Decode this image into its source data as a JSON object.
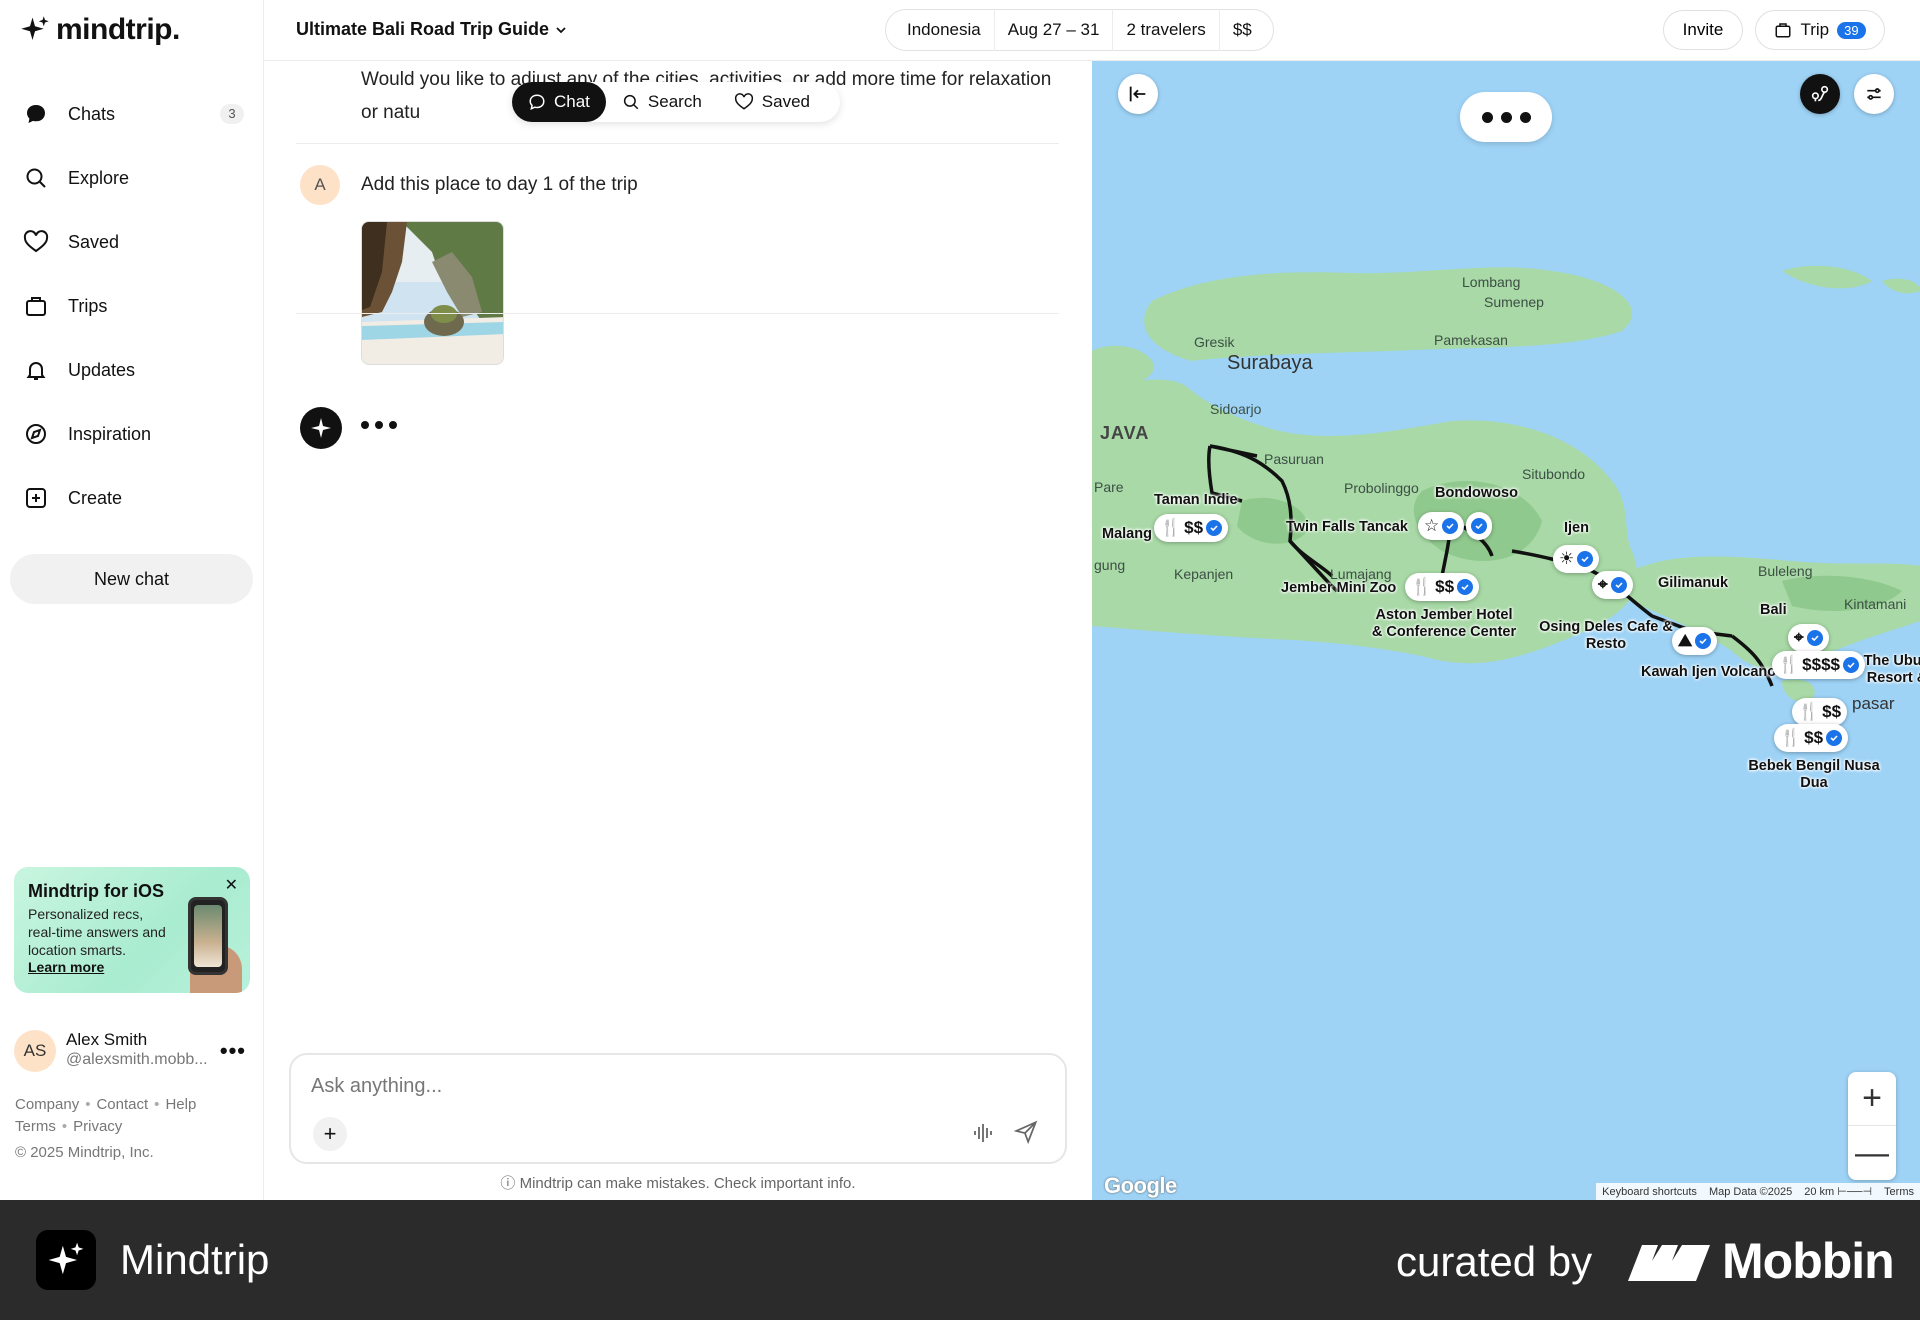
{
  "app": {
    "logo_text": "mindtrip."
  },
  "sidebar": {
    "items": [
      {
        "label": "Chats",
        "icon": "chat-bubble-icon",
        "badge": "3"
      },
      {
        "label": "Explore",
        "icon": "search-icon"
      },
      {
        "label": "Saved",
        "icon": "heart-icon"
      },
      {
        "label": "Trips",
        "icon": "suitcase-icon"
      },
      {
        "label": "Updates",
        "icon": "bell-icon"
      },
      {
        "label": "Inspiration",
        "icon": "compass-icon"
      },
      {
        "label": "Create",
        "icon": "plus-square-icon"
      }
    ],
    "new_chat_label": "New chat",
    "promo": {
      "title": "Mindtrip for iOS",
      "description": "Personalized recs, real-time answers and location smarts.",
      "link": "Learn more"
    },
    "user": {
      "initials": "AS",
      "name": "Alex Smith",
      "handle": "@alexsmith.mobb..."
    },
    "footer_links": [
      "Company",
      "Contact",
      "Help",
      "Terms",
      "Privacy"
    ],
    "copyright": "© 2025 Mindtrip, Inc."
  },
  "topbar": {
    "trip_title": "Ultimate Bali Road Trip Guide",
    "filters": [
      "Indonesia",
      "Aug 27 – 31",
      "2 travelers",
      "$$"
    ],
    "invite_label": "Invite",
    "trip_label": "Trip",
    "trip_count": "39"
  },
  "chat": {
    "prev_message": "Would you like to adjust any of the cities, activities, or add more time for relaxation or natu",
    "tabs": [
      {
        "label": "Chat",
        "icon": "chat-bubble-icon",
        "active": true
      },
      {
        "label": "Search",
        "icon": "search-icon",
        "active": false
      },
      {
        "label": "Saved",
        "icon": "heart-icon",
        "active": false
      }
    ],
    "user_initial": "A",
    "user_message": "Add this place to day 1 of the trip",
    "composer_placeholder": "Ask anything...",
    "disclaimer": "Mindtrip can make mistakes. Check important info."
  },
  "map": {
    "labels": {
      "lombang": "Lombang",
      "sumenep": "Sumenep",
      "gresik": "Gresik",
      "pamekasan": "Pamekasan",
      "surabaya": "Surabaya",
      "sidoarjo": "Sidoarjo",
      "java": "JAVA",
      "pasuruan": "Pasuruan",
      "situbondo": "Situbondo",
      "probolinggo": "Probolinggo",
      "pare": "Pare",
      "malang": "Malang",
      "gung": "gung",
      "kepanjen": "Kepanjen",
      "lumajang": "Lumajang",
      "buleleng": "Buleleng",
      "kintamani": "Kintamani",
      "bali": "Bali",
      "denpasar": "pasar"
    },
    "places": {
      "taman_indie": "Taman Indie",
      "bondowoso": "Bondowoso",
      "twin_falls": "Twin Falls Tancak",
      "ijen": "Ijen",
      "jember_zoo": "Jember Mini Zoo",
      "aston_jember": "Aston Jember Hotel & Conference Center",
      "gilimanuk": "Gilimanuk",
      "osing_deles": "Osing Deles Cafe & Resto",
      "kawah_ijen": "Kawah Ijen Volcano",
      "ubud_resort": "The Ubud Resort &",
      "bebek_bengil": "Bebek Bengil Nusa Dua"
    },
    "markers": {
      "malang_price": "$$",
      "jember_price": "$$",
      "bali_price_1": "$$$$",
      "bali_price_2": "$$",
      "bali_price_3": "$$"
    },
    "attribution": [
      "Keyboard shortcuts",
      "Map Data ©2025",
      "20 km",
      "Terms"
    ],
    "google_logo": "Google",
    "zoom_in": "+",
    "zoom_out": "—"
  },
  "brandbar": {
    "app_name": "Mindtrip",
    "curated_by": "curated by",
    "mobbin": "Mobbin"
  },
  "colors": {
    "accent": "#1a73e8",
    "land": "#a8d9a6",
    "water": "#9ed3f6",
    "brandbar": "#2b2b2b"
  }
}
